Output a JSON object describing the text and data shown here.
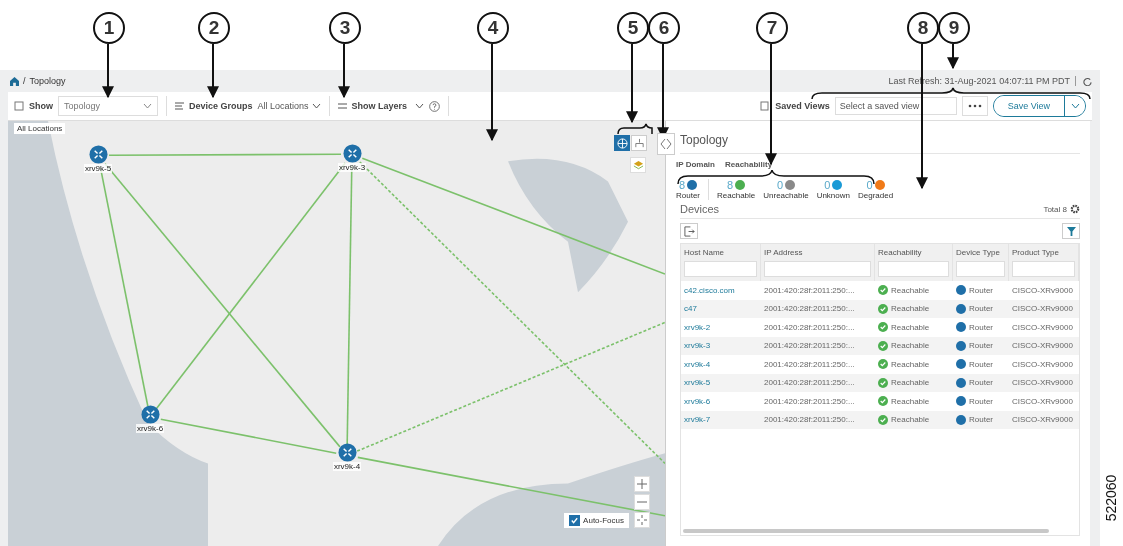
{
  "callouts": [
    "1",
    "2",
    "3",
    "4",
    "5",
    "6",
    "7",
    "8",
    "9"
  ],
  "breadcrumb": {
    "separator": "/",
    "page": "Topology"
  },
  "last_refresh": "Last Refresh: 31-Aug-2021 04:07:11 PM PDT",
  "toolbar": {
    "show_label": "Show",
    "show_value": "Topology",
    "groups_label": "Device Groups",
    "groups_value": "All Locations",
    "layers_label": "Show Layers",
    "saved_views_label": "Saved Views",
    "saved_view_placeholder": "Select a saved view",
    "save_button": "Save View"
  },
  "map": {
    "location_label": "All Locations",
    "view_modes": [
      {
        "kind": "geo",
        "selected": true
      },
      {
        "kind": "logical",
        "selected": false
      }
    ],
    "auto_focus": {
      "label": "Auto-Focus",
      "checked": true
    },
    "nodes": [
      {
        "name": "xrv9k-5"
      },
      {
        "name": "xrv9k-3"
      },
      {
        "name": "xrv9k-6"
      },
      {
        "name": "xrv9k-4"
      }
    ]
  },
  "panel": {
    "title": "Topology",
    "domain_label": "IP Domain",
    "reach_label": "Reachability",
    "summary": [
      {
        "count": "8",
        "label": "Router",
        "color": "#1f6fa8"
      },
      {
        "count": "8",
        "label": "Reachable",
        "color": "#4caf50"
      },
      {
        "count": "0",
        "label": "Unreachable",
        "color": "#8a8a8a"
      },
      {
        "count": "0",
        "label": "Unknown",
        "color": "#1b9ad6"
      },
      {
        "count": "0",
        "label": "Degraded",
        "color": "#f07a18"
      }
    ],
    "devices_title": "Devices",
    "total": "Total 8",
    "columns": [
      "Host Name",
      "IP Address",
      "Reachability",
      "Device Type",
      "Product Type"
    ],
    "rows": [
      {
        "host": "c42.cisco.com",
        "ip": "2001:420:28f:2011:250:...",
        "reach": "Reachable",
        "type": "Router",
        "product": "CISCO-XRv9000"
      },
      {
        "host": "c47",
        "ip": "2001:420:28f:2011:250:...",
        "reach": "Reachable",
        "type": "Router",
        "product": "CISCO-XRv9000"
      },
      {
        "host": "xrv9k-2",
        "ip": "2001:420:28f:2011:250:...",
        "reach": "Reachable",
        "type": "Router",
        "product": "CISCO-XRv9000"
      },
      {
        "host": "xrv9k-3",
        "ip": "2001:420:28f:2011:250:...",
        "reach": "Reachable",
        "type": "Router",
        "product": "CISCO-XRv9000"
      },
      {
        "host": "xrv9k-4",
        "ip": "2001:420:28f:2011:250:...",
        "reach": "Reachable",
        "type": "Router",
        "product": "CISCO-XRv9000"
      },
      {
        "host": "xrv9k-5",
        "ip": "2001:420:28f:2011:250:...",
        "reach": "Reachable",
        "type": "Router",
        "product": "CISCO-XRv9000"
      },
      {
        "host": "xrv9k-6",
        "ip": "2001:420:28f:2011:250:...",
        "reach": "Reachable",
        "type": "Router",
        "product": "CISCO-XRv9000"
      },
      {
        "host": "xrv9k-7",
        "ip": "2001:420:28f:2011:250:...",
        "reach": "Reachable",
        "type": "Router",
        "product": "CISCO-XRv9000"
      }
    ]
  },
  "figure_id": "522060"
}
